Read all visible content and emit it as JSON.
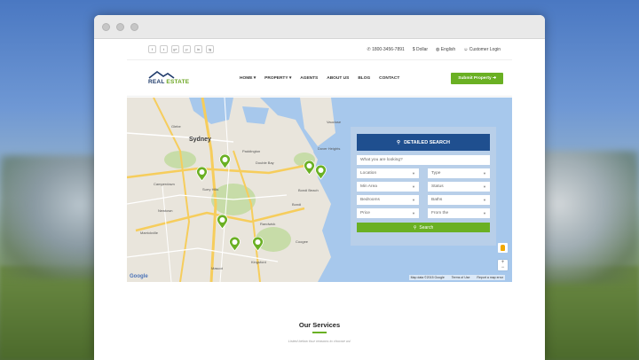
{
  "window": {
    "controls": [
      "close",
      "minimize",
      "maximize"
    ]
  },
  "topbar": {
    "social_icons": [
      "facebook",
      "twitter",
      "google-plus",
      "pinterest",
      "linkedin",
      "instagram"
    ],
    "social_glyphs": [
      "f",
      "t",
      "g+",
      "p",
      "in",
      "ig"
    ],
    "phone": "1800-3456-7891",
    "currency": "$ Dollar",
    "language": "English",
    "login": "Customer Login"
  },
  "header": {
    "logo_word1": "REAL",
    "logo_word2": "ESTATE",
    "nav": [
      "HOME",
      "PROPERTY",
      "AGENTS",
      "ABOUT US",
      "BLOG",
      "CONTACT"
    ],
    "submit_label": "Submit Property"
  },
  "search": {
    "title": "DETAILED SEARCH",
    "placeholder": "What you are looking?",
    "location": "Location",
    "type": "Type",
    "min_area": "Min Area",
    "status": "Status",
    "bedrooms": "Bedrooms",
    "baths": "Baths",
    "price": "Price",
    "from": "From the",
    "button": "Search"
  },
  "map": {
    "city": "Sydney",
    "labels": [
      "Surry Hills",
      "Bondi Beach",
      "Double Bay",
      "Kingsford",
      "Randwick",
      "Marrickville",
      "Bondi",
      "Coogee",
      "Camperdown",
      "Mascot",
      "Vaucluse",
      "Dover Heights",
      "Glebe",
      "Newtown",
      "Paddington"
    ],
    "google": "Google",
    "map_data": "Map data ©2015 Google",
    "terms": "Terms of Use",
    "report": "Report a map error",
    "zoom_in": "+",
    "zoom_out": "−"
  },
  "services": {
    "title": "Our Services",
    "subtitle": "Listed below four reasons to choose us!"
  },
  "colors": {
    "accent": "#6ab023",
    "brand": "#1f4f8f"
  }
}
